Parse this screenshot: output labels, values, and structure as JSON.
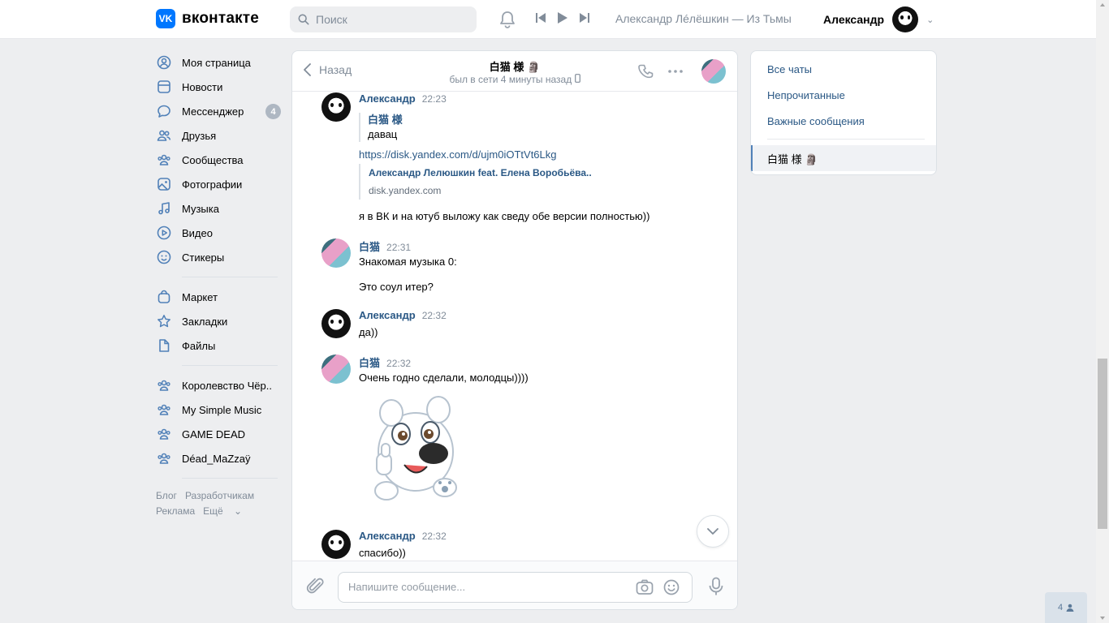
{
  "header": {
    "logo_text": "вконтакте",
    "logo_mark": "VK",
    "search_placeholder": "Поиск",
    "now_playing": "Александр Лéлёшкин — Из Тьмы",
    "profile_name": "Александр"
  },
  "sidebar": {
    "items": [
      {
        "label": "Моя страница",
        "icon": "user-circle-icon"
      },
      {
        "label": "Новости",
        "icon": "news-icon"
      },
      {
        "label": "Мессенджер",
        "icon": "message-icon",
        "badge": "4"
      },
      {
        "label": "Друзья",
        "icon": "friends-icon"
      },
      {
        "label": "Сообщества",
        "icon": "groups-icon"
      },
      {
        "label": "Фотографии",
        "icon": "photo-icon"
      },
      {
        "label": "Музыка",
        "icon": "music-icon"
      },
      {
        "label": "Видео",
        "icon": "video-icon"
      },
      {
        "label": "Стикеры",
        "icon": "sticker-icon"
      }
    ],
    "items2": [
      {
        "label": "Маркет",
        "icon": "market-icon"
      },
      {
        "label": "Закладки",
        "icon": "star-icon"
      },
      {
        "label": "Файлы",
        "icon": "file-icon"
      }
    ],
    "groups": [
      {
        "label": "Королевство Чёр.."
      },
      {
        "label": "My Simple Music"
      },
      {
        "label": "GAME DEAD"
      },
      {
        "label": "Déad_MaZzaÿ"
      }
    ],
    "footer": {
      "blog": "Блог",
      "dev": "Разработчикам",
      "ads": "Реклама",
      "more": "Ещё"
    }
  },
  "chat": {
    "back_label": "Назад",
    "title": "白猫 様 🗿",
    "status": "был в сети 4 минуты назад",
    "messages": [
      {
        "author": "Александр",
        "time": "22:23",
        "quote_author": "白猫 様",
        "quote_text": "давац",
        "link": "https://disk.yandex.com/d/ujm0iOTtVt6Lkg",
        "snippet_title": "Александр Лелюшкин feat. Елена Воробьёва..",
        "snippet_site": "disk.yandex.com",
        "text": "я в ВК и на ютуб выложу как сведу обе версии полностью))"
      },
      {
        "author": "白猫",
        "time": "22:31",
        "text1": "Знакомая музыка 0:",
        "text2": "Это соул итер?"
      },
      {
        "author": "Александр",
        "time": "22:32",
        "text": "да))"
      },
      {
        "author": "白猫",
        "time": "22:32",
        "text": "Очень годно сделали, молодцы))))"
      },
      {
        "author": "Александр",
        "time": "22:32",
        "text": "спасибо))"
      }
    ],
    "composer_placeholder": "Напишите сообщение..."
  },
  "right_panel": {
    "all_chats": "Все чаты",
    "unread": "Непрочитанные",
    "important": "Важные сообщения",
    "active_chat": "白猫 様 🗿"
  },
  "online_count": "4",
  "colors": {
    "accent": "#0077ff",
    "link": "#2a5885",
    "secondary_text": "#818c99",
    "background": "#edeef0",
    "badge": "#aeb7c2"
  }
}
